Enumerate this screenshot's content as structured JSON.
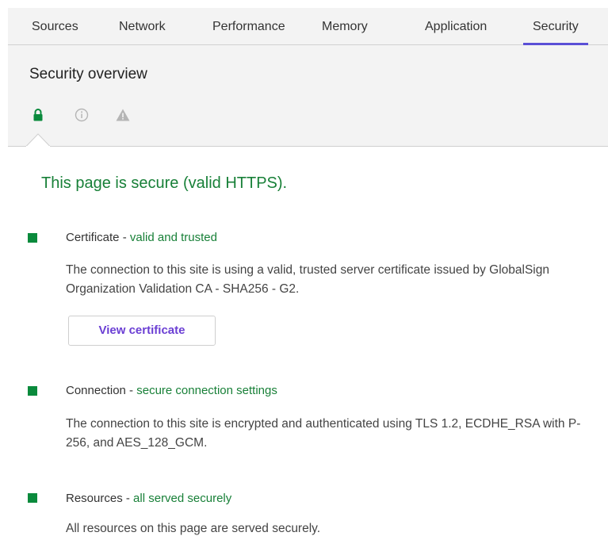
{
  "tabs": [
    {
      "label": "Sources",
      "active": false
    },
    {
      "label": "Network",
      "active": false
    },
    {
      "label": "Performance",
      "active": false
    },
    {
      "label": "Memory",
      "active": false
    },
    {
      "label": "Application",
      "active": false
    },
    {
      "label": "Security",
      "active": true
    }
  ],
  "colors": {
    "accent": "#5a4fd6",
    "secure_green": "#188038",
    "bullet_green": "#0a8a3c",
    "button_text": "#6b3fd4"
  },
  "header": {
    "title": "Security overview",
    "icons": [
      "lock-icon",
      "info-icon",
      "warning-icon"
    ]
  },
  "main": {
    "status_title": "This page is secure (valid HTTPS).",
    "sections": [
      {
        "icon": "green-square-icon",
        "label": "Certificate",
        "separator": " - ",
        "summary": "valid and trusted",
        "description": "The connection to this site is using a valid, trusted server certificate issued by GlobalSign Organization Validation CA - SHA256 - G2.",
        "button": "View certificate"
      },
      {
        "icon": "green-square-icon",
        "label": "Connection",
        "separator": " - ",
        "summary": "secure connection settings",
        "description": "The connection to this site is encrypted and authenticated using TLS 1.2, ECDHE_RSA with P-256, and AES_128_GCM."
      },
      {
        "icon": "green-square-icon",
        "label": "Resources",
        "separator": " - ",
        "summary": "all served securely",
        "description": "All resources on this page are served securely."
      }
    ]
  }
}
